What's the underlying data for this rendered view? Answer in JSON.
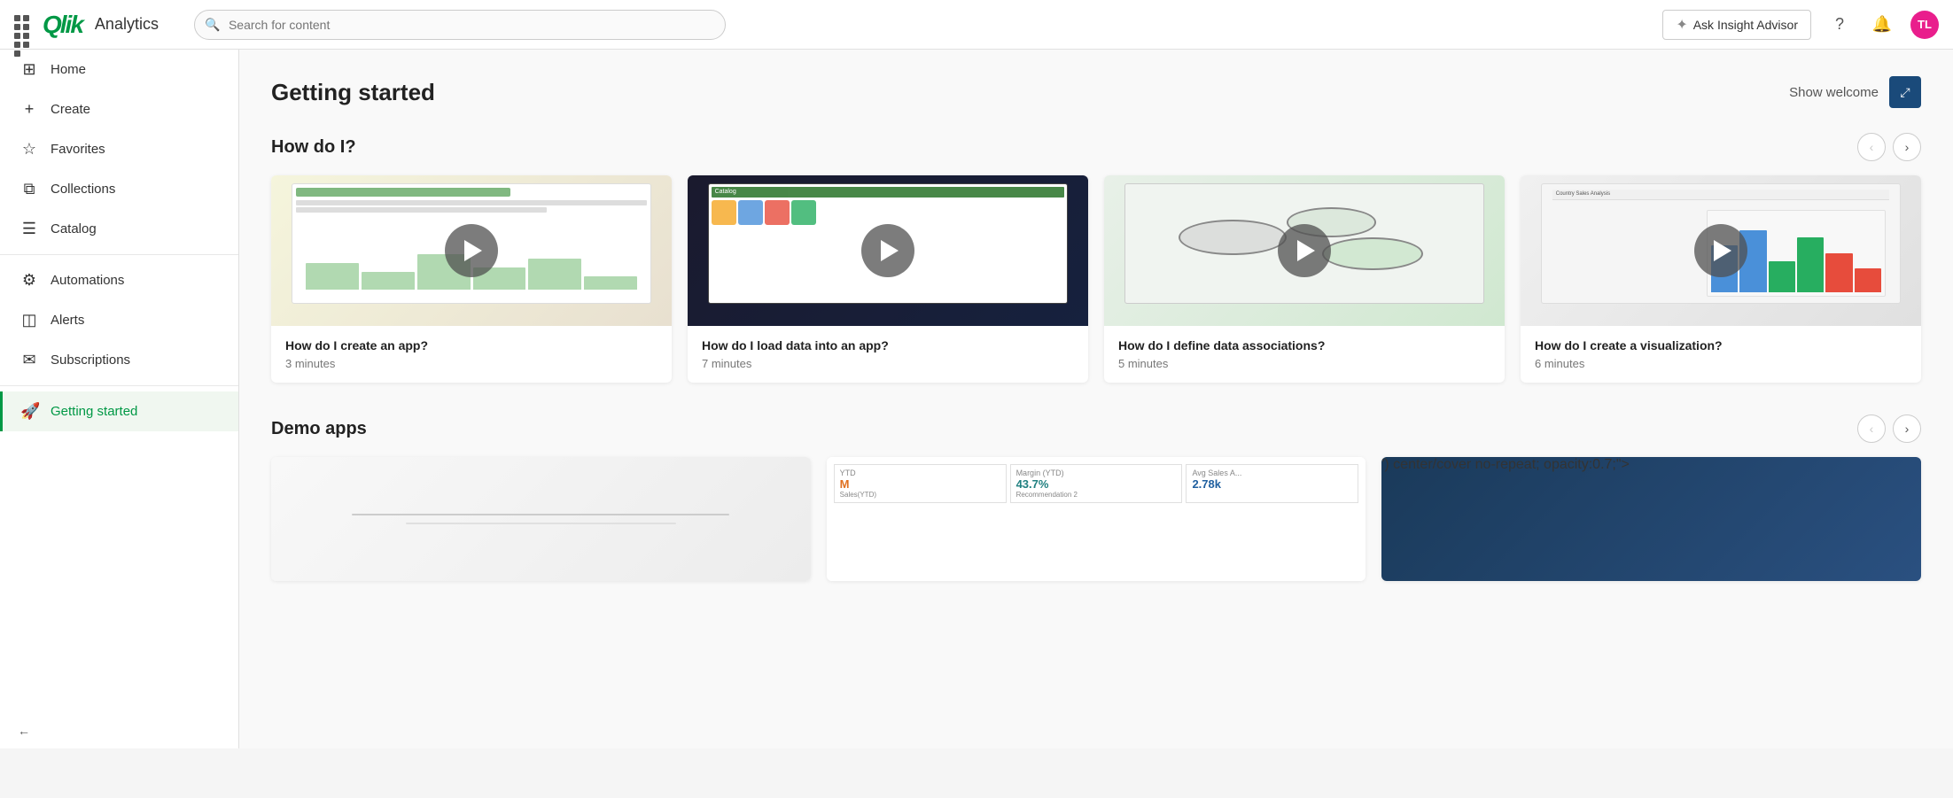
{
  "app": {
    "name": "Analytics"
  },
  "topbar": {
    "search_placeholder": "Search for content",
    "insight_btn_label": "Ask Insight Advisor",
    "help_tooltip": "Help",
    "notifications_tooltip": "Notifications",
    "user_initials": "TL"
  },
  "sidebar": {
    "items": [
      {
        "id": "home",
        "label": "Home",
        "icon": "⊞"
      },
      {
        "id": "create",
        "label": "Create",
        "icon": "+"
      },
      {
        "id": "favorites",
        "label": "Favorites",
        "icon": "☆"
      },
      {
        "id": "collections",
        "label": "Collections",
        "icon": "▣"
      },
      {
        "id": "catalog",
        "label": "Catalog",
        "icon": "☰"
      },
      {
        "id": "automations",
        "label": "Automations",
        "icon": "⚙"
      },
      {
        "id": "alerts",
        "label": "Alerts",
        "icon": "◫"
      },
      {
        "id": "subscriptions",
        "label": "Subscriptions",
        "icon": "✉"
      },
      {
        "id": "getting-started",
        "label": "Getting started",
        "icon": "🚀",
        "active": true
      }
    ],
    "collapse_label": "Collapse"
  },
  "main": {
    "page_title": "Getting started",
    "show_welcome": "Show welcome",
    "how_do_i": {
      "section_title": "How do I?",
      "videos": [
        {
          "id": "create-app",
          "title": "How do I create an app?",
          "duration": "3 minutes"
        },
        {
          "id": "load-data",
          "title": "How do I load data into an app?",
          "duration": "7 minutes"
        },
        {
          "id": "data-associations",
          "title": "How do I define data associations?",
          "duration": "5 minutes"
        },
        {
          "id": "create-viz",
          "title": "How do I create a visualization?",
          "duration": "6 minutes"
        }
      ]
    },
    "demo_apps": {
      "section_title": "Demo apps"
    }
  }
}
